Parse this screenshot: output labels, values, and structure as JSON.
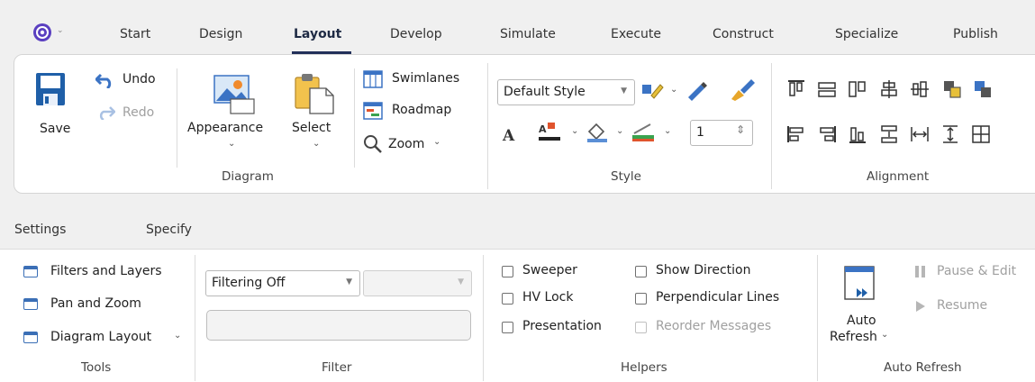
{
  "tabs": [
    "Start",
    "Design",
    "Layout",
    "Develop",
    "Simulate",
    "Execute",
    "Construct",
    "Specialize",
    "Publish"
  ],
  "active_tab": "Layout",
  "ribbon": {
    "save": "Save",
    "undo": "Undo",
    "redo": "Redo",
    "appearance": "Appearance",
    "select": "Select",
    "swimlanes": "Swimlanes",
    "roadmap": "Roadmap",
    "zoom": "Zoom",
    "diagram_group": "Diagram",
    "style_value": "Default Style",
    "line_width": "1",
    "style_group": "Style",
    "alignment_group": "Alignment"
  },
  "sections": [
    "Settings",
    "Specify"
  ],
  "tools": {
    "items": [
      "Filters and Layers",
      "Pan and Zoom",
      "Diagram Layout"
    ],
    "group": "Tools"
  },
  "filter": {
    "select_value": "Filtering Off",
    "group": "Filter"
  },
  "helpers": {
    "sweeper": "Sweeper",
    "hv_lock": "HV Lock",
    "presentation": "Presentation",
    "show_direction": "Show Direction",
    "perpendicular_lines": "Perpendicular Lines",
    "reorder_messages": "Reorder Messages",
    "group": "Helpers"
  },
  "auto_refresh": {
    "button_line1": "Auto",
    "button_line2": "Refresh",
    "pause_edit": "Pause & Edit",
    "resume": "Resume",
    "group": "Auto Refresh"
  },
  "colors": {
    "accent": "#22305a",
    "save_icon": "#1f5fa8",
    "undo_icon": "#3b73c4",
    "disabled_text": "#a0a0a0"
  }
}
